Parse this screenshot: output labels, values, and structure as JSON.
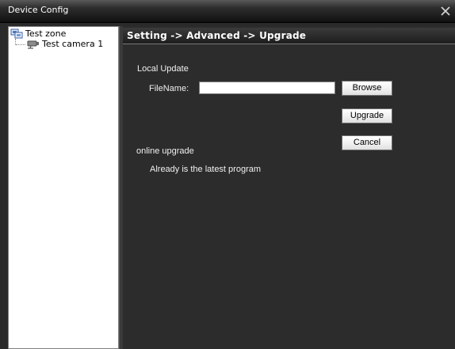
{
  "window": {
    "title": "Device Config",
    "close_icon": "close-icon"
  },
  "tree": {
    "root_label": "Test zone",
    "root_icon": "zone-icon",
    "child_label": "Test camera 1",
    "child_icon": "camera-icon"
  },
  "main": {
    "breadcrumb": "Setting -> Advanced -> Upgrade",
    "local_update_heading": "Local Update",
    "filename_label": "FileName:",
    "filename_value": "",
    "browse_label": "Browse",
    "upgrade_label": "Upgrade",
    "cancel_label": "Cancel",
    "online_upgrade_heading": "online upgrade",
    "online_status": "Already is the latest program"
  },
  "colors": {
    "background": "#2c2c2c",
    "title_bar": "#1a1a1a",
    "text": "#f0f0f0"
  }
}
